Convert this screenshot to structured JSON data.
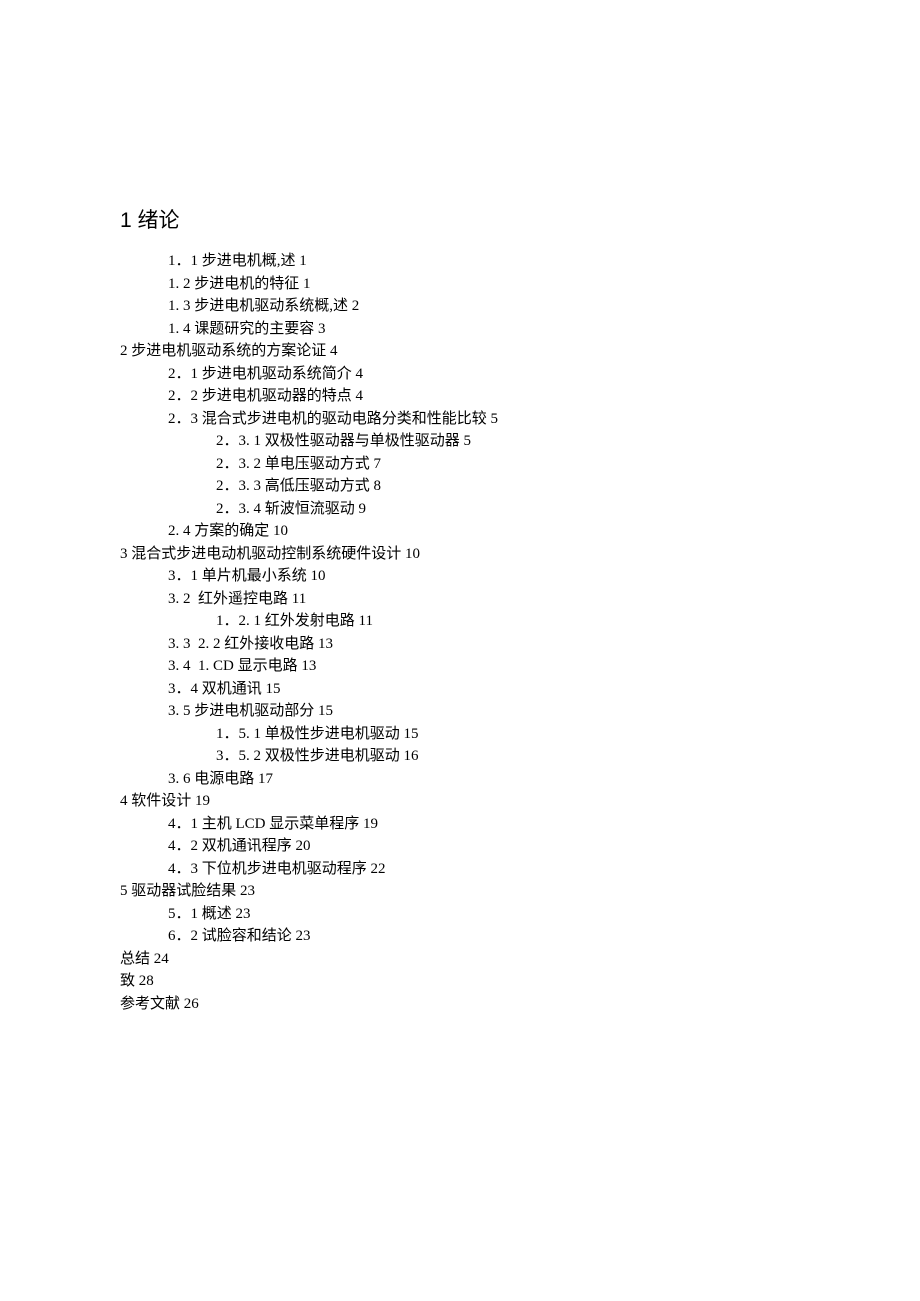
{
  "title": "1 绪论",
  "entries": [
    {
      "indent": 1,
      "text": "1．1 步进电机概,述 1"
    },
    {
      "indent": 1,
      "text": "1. 2 步进电机的特征 1"
    },
    {
      "indent": 1,
      "text": "1. 3 步进电机驱动系统概,述 2"
    },
    {
      "indent": 1,
      "text": "1. 4 课题研究的主要容 3"
    },
    {
      "indent": 0,
      "text": "2 步进电机驱动系统的方案论证 4"
    },
    {
      "indent": 1,
      "text": "2．1 步进电机驱动系统简介 4"
    },
    {
      "indent": 1,
      "text": "2．2 步进电机驱动器的特点 4"
    },
    {
      "indent": 1,
      "text": "2．3 混合式步进电机的驱动电路分类和性能比较 5"
    },
    {
      "indent": 2,
      "text": "2．3. 1 双极性驱动器与单极性驱动器 5"
    },
    {
      "indent": 2,
      "text": "2．3. 2 单电压驱动方式 7"
    },
    {
      "indent": 2,
      "text": "2．3. 3 高低压驱动方式 8"
    },
    {
      "indent": 2,
      "text": "2．3. 4 斩波恒流驱动 9"
    },
    {
      "indent": 1,
      "text": "2. 4 方案的确定 10"
    },
    {
      "indent": 0,
      "text": "3 混合式步进电动机驱动控制系统硬件设计 10"
    },
    {
      "indent": 1,
      "text": "3．1 单片机最小系统 10"
    },
    {
      "indent": 1,
      "text": "3. 2  红外遥控电路 11"
    },
    {
      "indent": 2,
      "text": "1．2. 1 红外发射电路 11"
    },
    {
      "indent": 1,
      "text": "3. 3  2. 2 红外接收电路 13"
    },
    {
      "indent": 1,
      "text": "3. 4  1. CD 显示电路 13"
    },
    {
      "indent": 1,
      "text": "3．4 双机通讯 15"
    },
    {
      "indent": 1,
      "text": "3. 5 步进电机驱动部分 15"
    },
    {
      "indent": 2,
      "text": "1．5. 1 单极性步进电机驱动 15"
    },
    {
      "indent": 2,
      "text": "3．5. 2 双极性步进电机驱动 16"
    },
    {
      "indent": 1,
      "text": "3. 6 电源电路 17"
    },
    {
      "indent": 0,
      "text": "4 软件设计 19"
    },
    {
      "indent": 1,
      "text": "4．1 主机 LCD 显示菜单程序 19"
    },
    {
      "indent": 1,
      "text": "4．2 双机通讯程序 20"
    },
    {
      "indent": 1,
      "text": "4．3 下位机步进电机驱动程序 22"
    },
    {
      "indent": 0,
      "text": "5 驱动器试脸结果 23"
    },
    {
      "indent": 1,
      "text": "5．1 概述 23"
    },
    {
      "indent": 1,
      "text": "6．2 试脸容和结论 23"
    },
    {
      "indent": 0,
      "text": "总结 24"
    },
    {
      "indent": 0,
      "text": "致 28"
    },
    {
      "indent": 0,
      "text": "参考文献 26"
    }
  ]
}
